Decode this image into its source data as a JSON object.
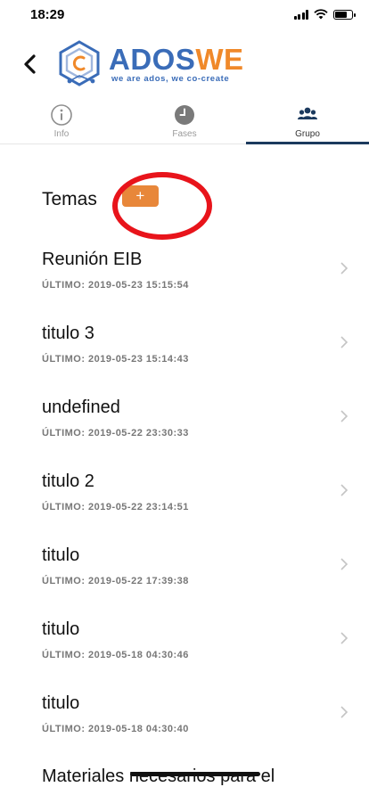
{
  "status_bar": {
    "time": "18:29"
  },
  "header": {
    "logo_word_a": "ADOS",
    "logo_word_b": "WE",
    "logo_tagline": "we are ados, we co-create"
  },
  "tabs": [
    {
      "label": "Info",
      "icon": "info-icon",
      "active": false
    },
    {
      "label": "Fases",
      "icon": "clock-icon",
      "active": false
    },
    {
      "label": "Grupo",
      "icon": "group-icon",
      "active": true
    }
  ],
  "section": {
    "title": "Temas",
    "add_label": "+"
  },
  "topics": [
    {
      "title": "Reunión EIB",
      "meta": "ÚLTIMO: 2019-05-23 15:15:54"
    },
    {
      "title": "titulo 3",
      "meta": "ÚLTIMO: 2019-05-23 15:14:43"
    },
    {
      "title": "undefined",
      "meta": "ÚLTIMO: 2019-05-22 23:30:33"
    },
    {
      "title": "titulo 2",
      "meta": "ÚLTIMO: 2019-05-22 23:14:51"
    },
    {
      "title": "titulo",
      "meta": "ÚLTIMO: 2019-05-22 17:39:38"
    },
    {
      "title": "titulo",
      "meta": "ÚLTIMO: 2019-05-18 04:30:46"
    },
    {
      "title": "titulo",
      "meta": "ÚLTIMO: 2019-05-18 04:30:40"
    }
  ],
  "bottom_text": "Materiales necesarios para el",
  "colors": {
    "brand_blue": "#3a6cb8",
    "brand_orange": "#f0892a",
    "add_button": "#e8873a",
    "highlight": "#e8141b",
    "tab_indicator": "#1c3a5e"
  }
}
